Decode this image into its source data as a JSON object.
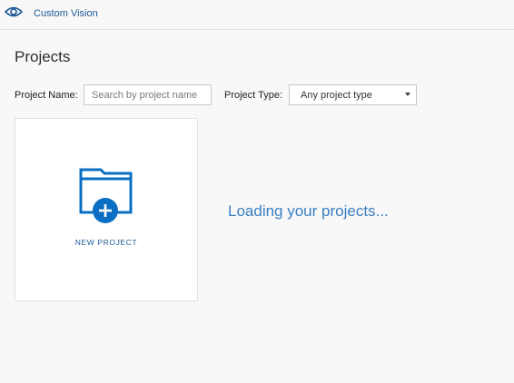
{
  "header": {
    "app_title": "Custom Vision",
    "logo_icon": "eye-icon"
  },
  "page": {
    "title": "Projects"
  },
  "filters": {
    "name_label": "Project Name:",
    "search_placeholder": "Search by project name",
    "type_label": "Project Type:",
    "type_selected": "Any project type"
  },
  "new_project": {
    "label": "NEW PROJECT",
    "icon": "folder-add-icon"
  },
  "status": {
    "loading": "Loading your projects..."
  },
  "colors": {
    "brand": "#1c5a96",
    "accent": "#0a6fc2",
    "loading": "#3a7fc1",
    "background": "#f8f8f8"
  }
}
